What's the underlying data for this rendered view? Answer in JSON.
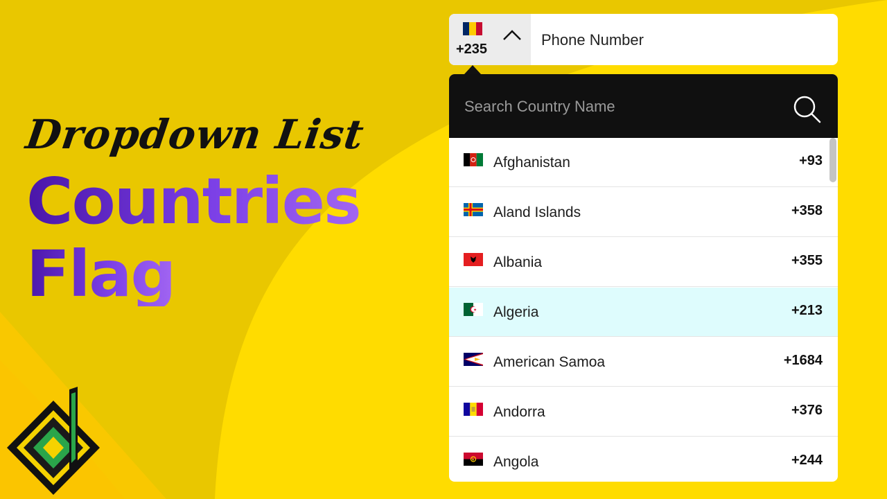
{
  "hero": {
    "script_title": "Dropdown List",
    "line1": "Countries",
    "line2": "Flag"
  },
  "colors": {
    "background": "#f5d200",
    "background_dark": "#e8c600",
    "accent_purple": "#6a2fd6",
    "dropdown_header": "#101010",
    "highlight_row": "#defcfd"
  },
  "phone": {
    "selected_code": "+235",
    "selected_flag": "chad-flag-icon",
    "placeholder": "Phone Number",
    "toggle_icon": "chevron-up-icon"
  },
  "dropdown": {
    "search_placeholder": "Search Country Name",
    "search_icon": "search-icon",
    "countries": [
      {
        "name": "Afghanistan",
        "code": "+93",
        "flag": "afghanistan-flag-icon"
      },
      {
        "name": "Aland Islands",
        "code": "+358",
        "flag": "aland-islands-flag-icon"
      },
      {
        "name": "Albania",
        "code": "+355",
        "flag": "albania-flag-icon"
      },
      {
        "name": "Algeria",
        "code": "+213",
        "flag": "algeria-flag-icon",
        "highlighted": true
      },
      {
        "name": "American Samoa",
        "code": "+1684",
        "flag": "american-samoa-flag-icon"
      },
      {
        "name": "Andorra",
        "code": "+376",
        "flag": "andorra-flag-icon"
      },
      {
        "name": "Angola",
        "code": "+244",
        "flag": "angola-flag-icon"
      }
    ]
  },
  "logo": {
    "icon": "brand-logo-icon"
  }
}
